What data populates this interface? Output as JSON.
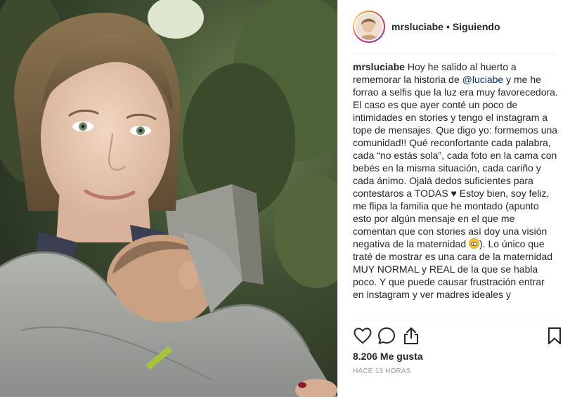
{
  "post": {
    "username": "mrsluciabe",
    "separator": "•",
    "follow_status": "Siguiendo",
    "avatar": "profile-avatar",
    "caption": {
      "user": "mrsluciabe",
      "part1": " Hoy he salido al huerto a rememorar la historia de ",
      "mention": "@luciabe",
      "part2": " y me he forrao a selfis que la luz era muy favorecedora. El caso es que ayer conté un poco de intimidades en stories y tengo el instagram a tope de mensajes. Que digo yo: formemos una comunidad!! Qué reconfortante cada palabra, cada “no estás sola”, cada foto en la cama con bebés en la misma situación, cada cariño y cada ánimo. Ojalá dedos suficientes para contestaros a TODAS ♥ Estoy bien, soy feliz, me flipa la familia que he montado (apunto esto por algún mensaje en el que me comentan que con stories así doy una visión negativa de la maternidad ",
      "emoji": "flushed-face-emoji",
      "part3": "). Lo único que traté de mostrar es una cara de la maternidad MUY NORMAL y REAL de la que se habla poco. Y que puede causar frustración entrar en instagram y ver madres ideales y"
    },
    "icons": {
      "like": "heart-icon",
      "comment": "comment-icon",
      "share": "share-icon",
      "save": "bookmark-icon"
    },
    "likes": "8.206 Me gusta",
    "timestamp": "HACE 13 HORAS",
    "photo": "selfie-mother-with-baby-in-wrap"
  }
}
